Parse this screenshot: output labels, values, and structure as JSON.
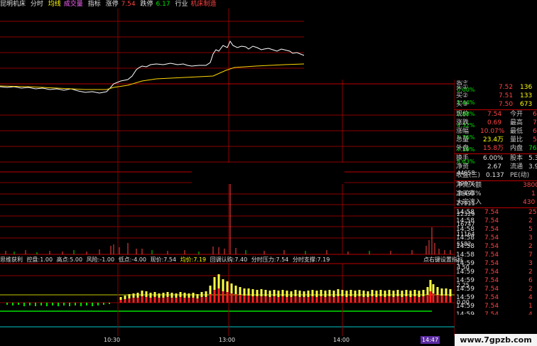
{
  "topbar": {
    "name": "昆明机床",
    "tab_fenshi": "分时",
    "junxian": "均线",
    "chengjiaoliang": "成交量",
    "zhibiao": "指标",
    "zhangting_label": "涨停",
    "zhangting_val": "7.54",
    "dieting_label": "跌停",
    "dieting_val": "6.17",
    "hangye_label": "行业",
    "hangye_val": "机床制造"
  },
  "price_axis": [
    "0.00%",
    "1.44%",
    "2.88%",
    "4.32%",
    "5.76%",
    "7.19%",
    "8.63%"
  ],
  "volume_axis": [
    "44658",
    "39076",
    "33493",
    "27911",
    "22329",
    "16747",
    "11164",
    "5582"
  ],
  "indicator_axis": [
    "4.50",
    "2.25",
    "0.00"
  ],
  "indicator_bar": {
    "title": "思维获利",
    "items": [
      "控盘:1.00",
      "高点:5.00",
      "风险:-1.00",
      "低点:-4.00",
      "现价:7.54",
      "均价:7.19",
      "回调认购:7.40",
      "分时压力:7.54",
      "分时支撑:7.19"
    ],
    "right_label": "点右键设置指标"
  },
  "time_axis": [
    "10:30",
    "13:00",
    "14:00",
    "14:47"
  ],
  "quote": {
    "asks": [
      {
        "label": "卖⑤",
        "price": "",
        "vol": ""
      },
      {
        "label": "买①",
        "price": "7.52",
        "vol": "136"
      },
      {
        "label": "买②",
        "price": "7.51",
        "vol": "133"
      },
      {
        "label": "买③",
        "price": "7.50",
        "vol": "673"
      }
    ],
    "stats": [
      {
        "l1": "现价",
        "v1": "7.54",
        "l2": "今开",
        "v2": "6"
      },
      {
        "l1": "涨跌",
        "v1": "0.69",
        "l2": "最高",
        "v2": "7"
      },
      {
        "l1": "涨幅",
        "v1": "10.07%",
        "l2": "最低",
        "v2": "6"
      },
      {
        "l1": "总量",
        "v1": "23.4万",
        "l2": "量比",
        "v2": "5"
      },
      {
        "l1": "外盘",
        "v1": "15.8万",
        "l2": "内盘",
        "v2": "76"
      },
      {
        "l1": "换手",
        "v1": "6.00%",
        "l2": "股本",
        "v2": "5.3"
      },
      {
        "l1": "净资",
        "v1": "2.67",
        "l2": "流通",
        "v2": "3.9"
      },
      {
        "l1": "收益(三)",
        "v1": "0.137",
        "l2": "PE(动)",
        "v2": ""
      }
    ],
    "flow": [
      {
        "label": "净流入额",
        "val": "3800"
      },
      {
        "label": "净买率%",
        "val": "1"
      },
      {
        "label": "大宗流入",
        "val": "430"
      }
    ],
    "ticks": [
      {
        "t": "14:58",
        "p": "7.54",
        "v": "25"
      },
      {
        "t": "14:58",
        "p": "7.54",
        "v": "2"
      },
      {
        "t": "14:58",
        "p": "7.54",
        "v": "5"
      },
      {
        "t": "14:58",
        "p": "7.54",
        "v": "3"
      },
      {
        "t": "14:58",
        "p": "7.54",
        "v": "2"
      },
      {
        "t": "14:58",
        "p": "7.54",
        "v": "7"
      },
      {
        "t": "14:59",
        "p": "7.54",
        "v": "3"
      },
      {
        "t": "14:59",
        "p": "7.54",
        "v": "2"
      },
      {
        "t": "14:59",
        "p": "7.54",
        "v": "6"
      },
      {
        "t": "14:59",
        "p": "7.54",
        "v": "2"
      },
      {
        "t": "14:59",
        "p": "7.54",
        "v": "4"
      },
      {
        "t": "14:59",
        "p": "7.54",
        "v": "1"
      },
      {
        "t": "14:59",
        "p": "7.54",
        "v": "4"
      }
    ]
  },
  "watermark": "www.7gpzb.com",
  "colors": {
    "up": "#ff4444",
    "down": "#00e000",
    "grid": "#8b0000",
    "price_line": "#ffffff",
    "avg_line": "#ffd700"
  }
}
